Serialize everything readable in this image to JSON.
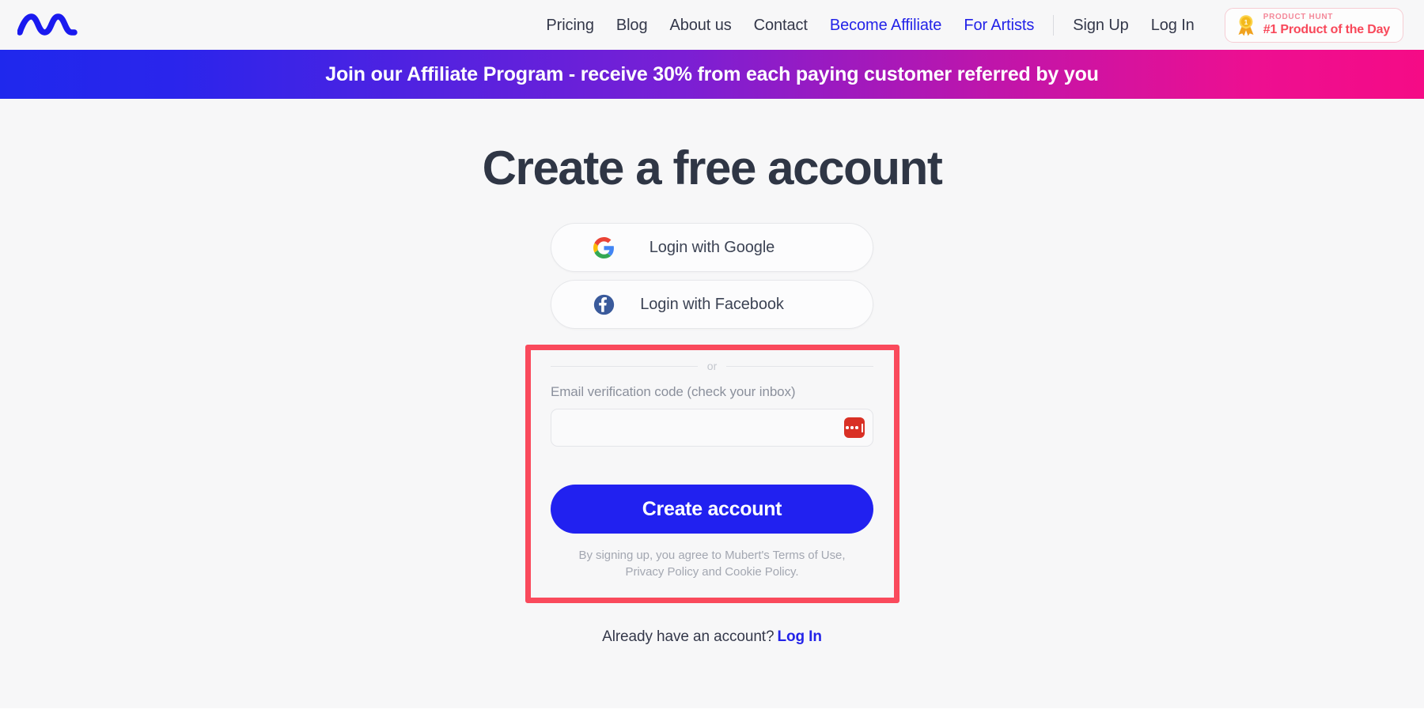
{
  "header": {
    "logo_name": "mubert-wave-logo",
    "nav": [
      {
        "label": "Pricing",
        "accent": false
      },
      {
        "label": "Blog",
        "accent": false
      },
      {
        "label": "About us",
        "accent": false
      },
      {
        "label": "Contact",
        "accent": false
      },
      {
        "label": "Become Affiliate",
        "accent": true
      },
      {
        "label": "For Artists",
        "accent": true
      }
    ],
    "auth": [
      {
        "label": "Sign Up"
      },
      {
        "label": "Log In"
      }
    ],
    "product_hunt": {
      "kicker": "PRODUCT HUNT",
      "title": "#1 Product of the Day",
      "medal_icon": "medal-ribbon-icon",
      "border_color": "#f6cdd4",
      "title_color": "#f8485a"
    }
  },
  "banner": {
    "text": "Join our Affiliate Program - receive 30% from each paying customer referred by you",
    "gradient_start": "#1f28ed",
    "gradient_end": "#f50b86"
  },
  "main": {
    "title": "Create a free account",
    "social_buttons": [
      {
        "label": "Login with Google",
        "icon": "google-g-icon"
      },
      {
        "label": "Login with Facebook",
        "icon": "facebook-f-icon"
      }
    ],
    "divider_text": "or",
    "field": {
      "label": "Email verification code (check your inbox)",
      "value": "",
      "placeholder": ""
    },
    "password_manager_icon": "password-manager-icon",
    "submit_label": "Create account",
    "submit_color": "#2121f0",
    "terms_line_1": "By signing up, you agree to Mubert's Terms of Use,",
    "terms_line_2": "Privacy Policy and Cookie Policy.",
    "footer_prompt": "Already have an account?",
    "footer_link": "Log In",
    "annotation_color": "#fa4a5c"
  }
}
